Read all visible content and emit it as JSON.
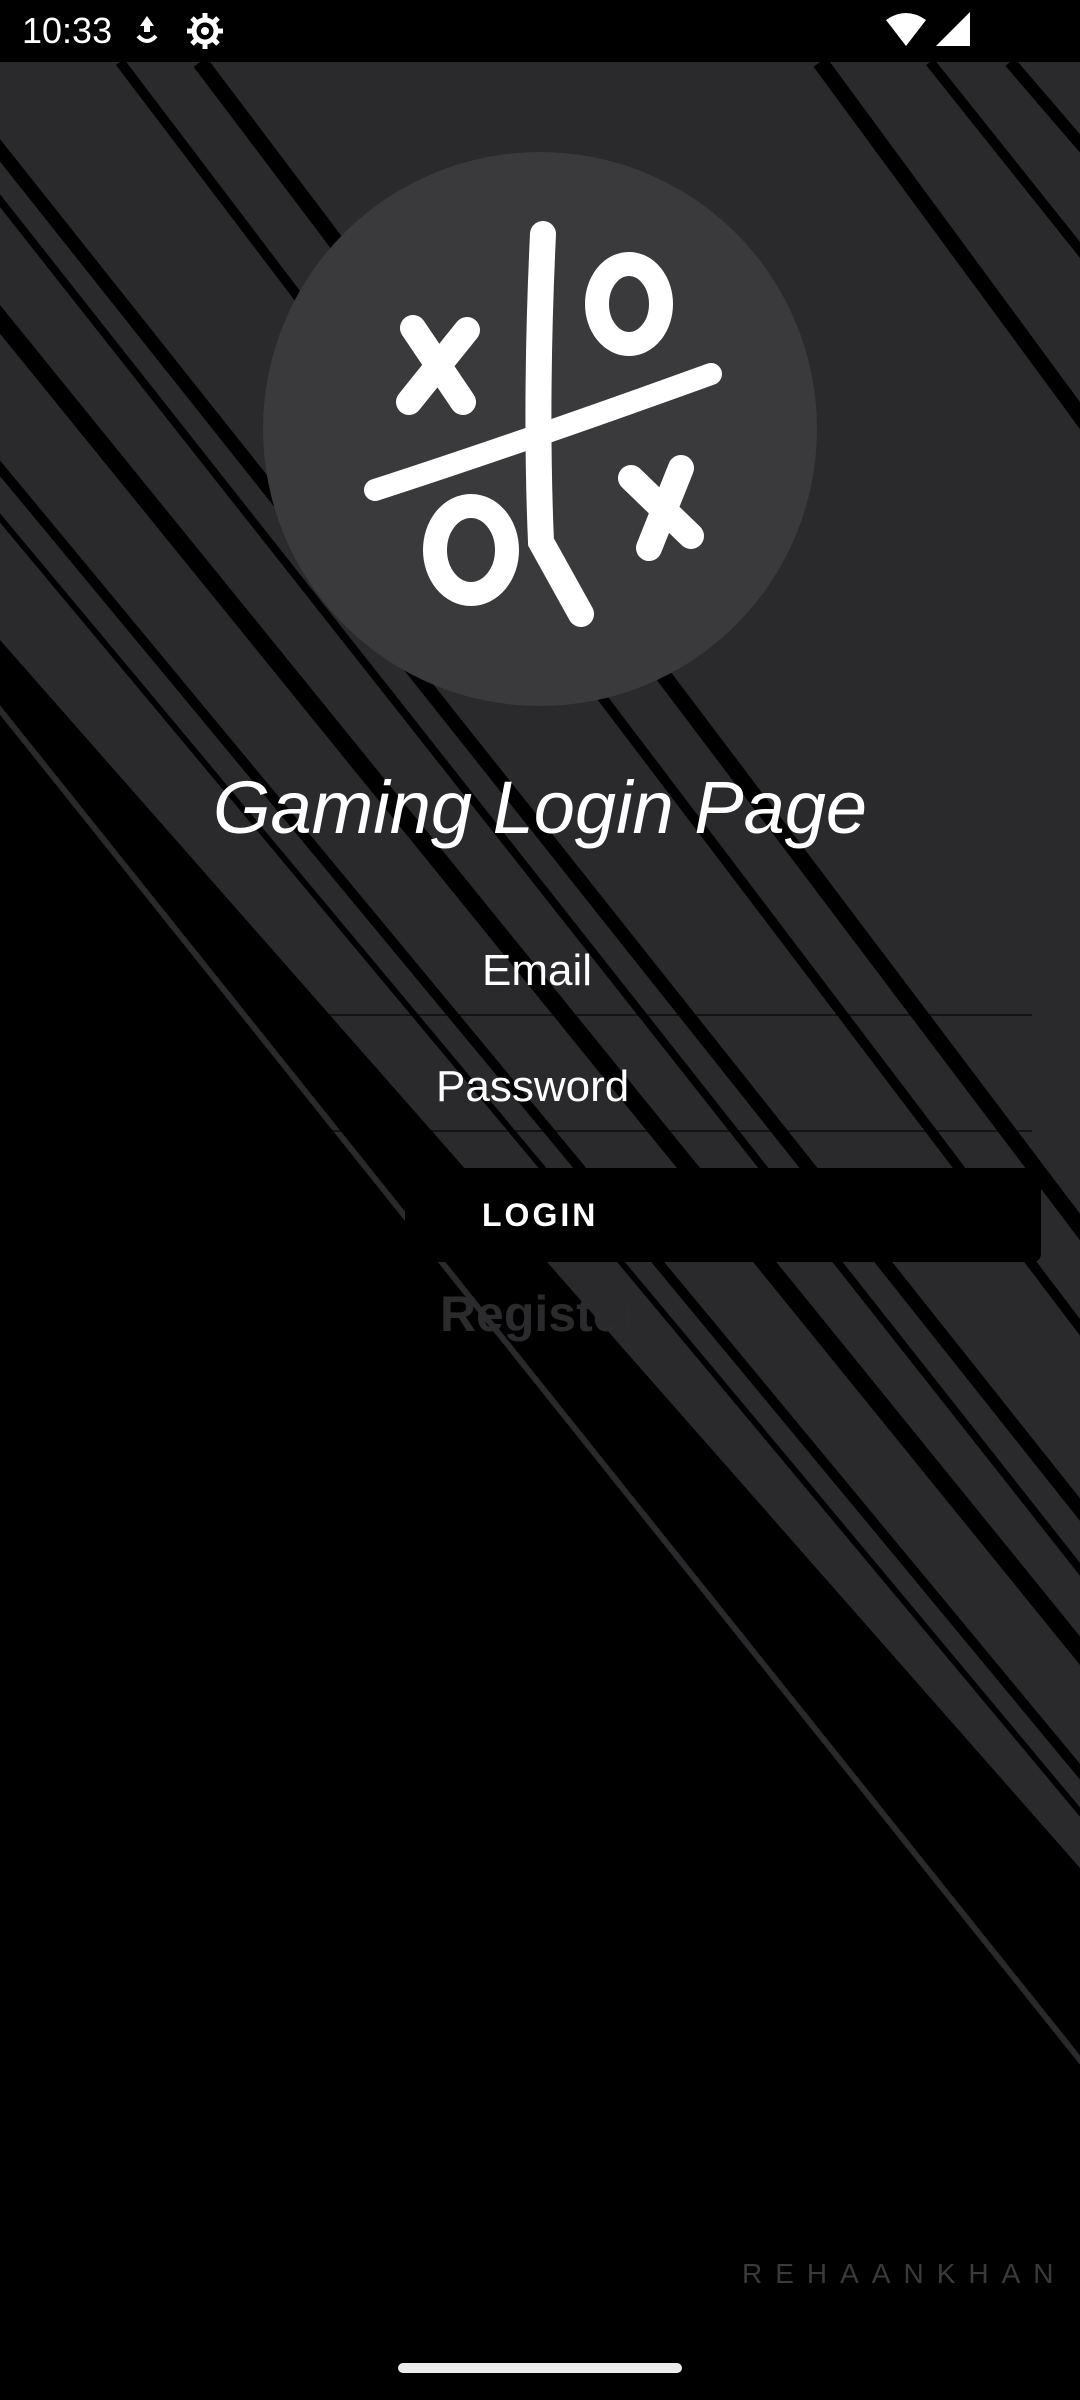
{
  "status_bar": {
    "time": "10:33",
    "icons": [
      "data-saver-icon",
      "settings-gear-icon",
      "wifi-icon",
      "cellular-signal-icon"
    ]
  },
  "logo": {
    "icon": "tic-tac-toe-icon"
  },
  "title": "Gaming Login Page",
  "form": {
    "email_placeholder": "Email",
    "password_placeholder": "Password",
    "login_label": "LOGIN",
    "register_label": "Register"
  },
  "watermark": "REHAANKHAN",
  "colors": {
    "background": "#000000",
    "stripe": "#2a2a2c",
    "logo_circle": "#3a3a3d"
  }
}
